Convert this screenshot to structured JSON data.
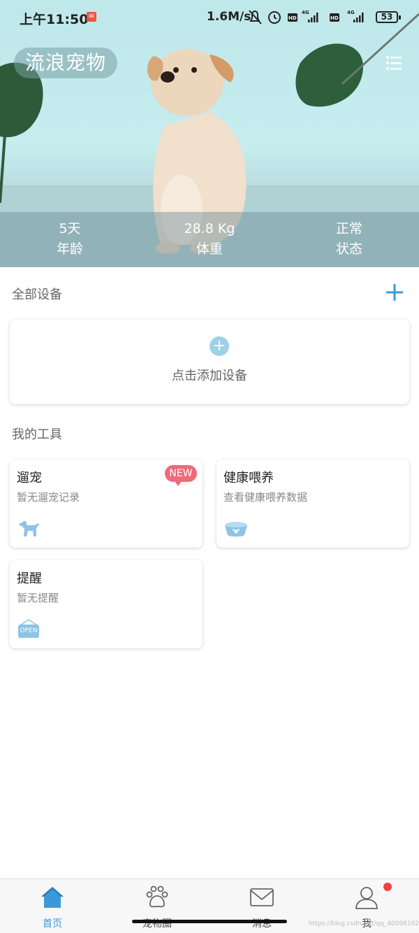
{
  "status_bar": {
    "time": "上午11:50",
    "speed": "1.6M/s",
    "battery": "53"
  },
  "header": {
    "app_title": "流浪宠物",
    "menu_icon": "list-menu-icon"
  },
  "pet_stats": [
    {
      "value": "5天",
      "label": "年龄"
    },
    {
      "value": "28.8 Kg",
      "label": "体重"
    },
    {
      "value": "正常",
      "label": "状态"
    }
  ],
  "devices": {
    "title": "全部设备",
    "add_prompt": "点击添加设备"
  },
  "tools": {
    "title": "我的工具",
    "items": [
      {
        "title": "遛宠",
        "subtitle": "暂无遛宠记录",
        "badge": "NEW",
        "icon": "walking-dog-icon"
      },
      {
        "title": "健康喂养",
        "subtitle": "查看健康喂养数据",
        "icon": "pet-bowl-icon"
      },
      {
        "title": "提醒",
        "subtitle": "暂无提醒",
        "icon": "open-sign-icon",
        "icon_text": "OPEN"
      }
    ]
  },
  "bottom_nav": [
    {
      "label": "首页",
      "icon": "home-icon",
      "active": true
    },
    {
      "label": "宠物圈",
      "icon": "paw-icon"
    },
    {
      "label": "消息",
      "icon": "mail-icon"
    },
    {
      "label": "我",
      "icon": "user-icon",
      "has_notification": true
    }
  ],
  "watermark": "https://blog.csdn.net/qq_40098162",
  "colors": {
    "accent": "#3a9ad9",
    "badge": "#f06a7a",
    "hero_bg": "#c6ecee"
  }
}
